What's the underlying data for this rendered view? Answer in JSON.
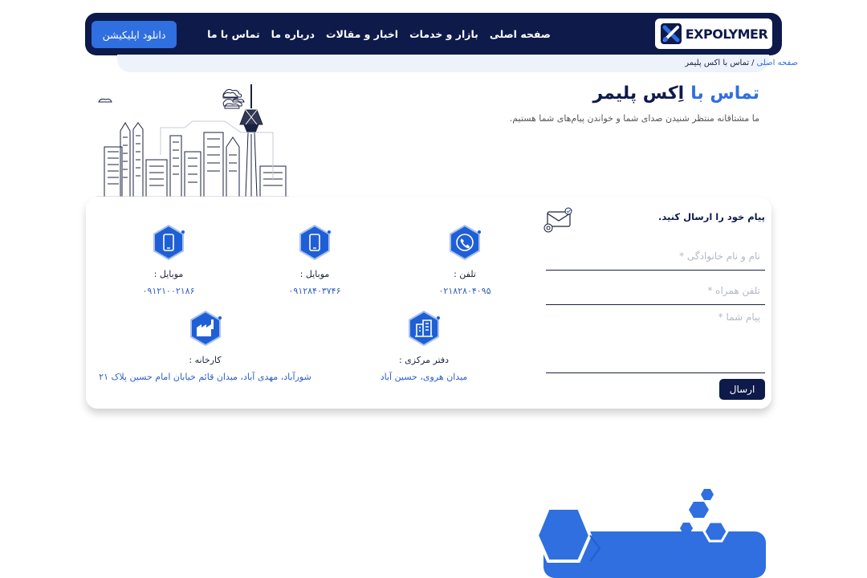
{
  "header": {
    "logo_text": "EXPOLYMER",
    "nav": [
      "صفحه اصلی",
      "بازار و خدمات",
      "اخبار و مقالات",
      "درباره ما",
      "تماس با ما"
    ],
    "app_button": "دانلود اپلیکیشن"
  },
  "breadcrumb": {
    "home": "صفحه اصلی",
    "separator": "/",
    "current": "تماس با اکس پلیمر"
  },
  "page": {
    "title_part1": "تماس با",
    "title_part2": "اِکس پلیمر",
    "subtitle": "ما مشتاقانه منتظر شنیدن صدای شما و خواندن پیام‌های شما هستیم."
  },
  "form": {
    "title": "پیام خود را ارسال کنید.",
    "name_placeholder": "نام و نام خانوادگی *",
    "phone_placeholder": "تلفن همراه *",
    "message_placeholder": "پیام شما *",
    "submit": "ارسال"
  },
  "contacts": {
    "phone": {
      "label": "تلفن :",
      "value": "۰۲۱۸۲۸۰۴۰۹۵",
      "icon": "phone-icon"
    },
    "mobile1": {
      "label": "موبایل :",
      "value": "۰۹۱۲۸۴۰۳۷۴۶",
      "icon": "mobile-icon"
    },
    "mobile2": {
      "label": "موبایل :",
      "value": "۰۹۱۲۱۰۰۲۱۸۶",
      "icon": "mobile-icon"
    },
    "office": {
      "label": "دفتر مرکزی :",
      "value": "میدان هروی، حسین آباد",
      "icon": "building-icon"
    },
    "factory": {
      "label": "کارخانه :",
      "value": "شورآباد، مهدی آباد، میدان قائم خیابان امام حسین پلاک ۲۱",
      "icon": "factory-icon"
    }
  },
  "colors": {
    "navy": "#0d1a4a",
    "accent": "#2f6fe0"
  }
}
